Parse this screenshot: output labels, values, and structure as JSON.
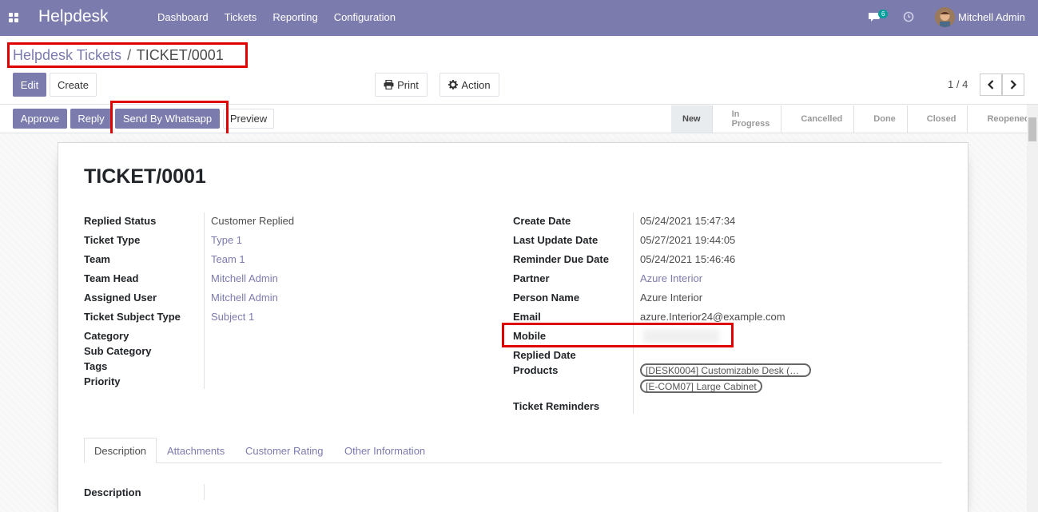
{
  "navbar": {
    "brand": "Helpdesk",
    "menu": [
      "Dashboard",
      "Tickets",
      "Reporting",
      "Configuration"
    ],
    "chat_count": "6",
    "user_name": "Mitchell Admin"
  },
  "breadcrumb": {
    "parent": "Helpdesk Tickets",
    "separator": "/",
    "current": "TICKET/0001"
  },
  "toolbar": {
    "edit": "Edit",
    "create": "Create",
    "print": "Print",
    "action": "Action",
    "pager": "1 / 4"
  },
  "status_buttons": {
    "approve": "Approve",
    "reply": "Reply",
    "send_whatsapp": "Send By Whatsapp",
    "preview": "Preview"
  },
  "stages": [
    "New",
    "In Progress",
    "Cancelled",
    "Done",
    "Closed",
    "Reopened"
  ],
  "active_stage": "New",
  "ticket": {
    "title": "TICKET/0001",
    "left_fields": {
      "replied_status": {
        "label": "Replied Status",
        "value": "Customer Replied"
      },
      "ticket_type": {
        "label": "Ticket Type",
        "value": "Type 1"
      },
      "team": {
        "label": "Team",
        "value": "Team 1"
      },
      "team_head": {
        "label": "Team Head",
        "value": "Mitchell Admin"
      },
      "assigned_user": {
        "label": "Assigned User",
        "value": "Mitchell Admin"
      },
      "subject_type": {
        "label": "Ticket Subject Type",
        "value": "Subject 1"
      },
      "category": {
        "label": "Category",
        "value": ""
      },
      "sub_category": {
        "label": "Sub Category",
        "value": ""
      },
      "tags": {
        "label": "Tags",
        "value": ""
      },
      "priority": {
        "label": "Priority",
        "value": ""
      }
    },
    "right_fields": {
      "create_date": {
        "label": "Create Date",
        "value": "05/24/2021 15:47:34"
      },
      "last_update": {
        "label": "Last Update Date",
        "value": "05/27/2021 19:44:05"
      },
      "reminder_due": {
        "label": "Reminder Due Date",
        "value": "05/24/2021 15:46:46"
      },
      "partner": {
        "label": "Partner",
        "value": "Azure Interior"
      },
      "person_name": {
        "label": "Person Name",
        "value": "Azure Interior"
      },
      "email": {
        "label": "Email",
        "value": "azure.Interior24@example.com"
      },
      "mobile": {
        "label": "Mobile",
        "value": ""
      },
      "replied_date": {
        "label": "Replied Date",
        "value": ""
      },
      "products": {
        "label": "Products",
        "items": [
          "[DESK0004] Customizable Desk (…",
          "[E-COM07] Large Cabinet"
        ]
      },
      "reminders": {
        "label": "Ticket Reminders",
        "value": ""
      }
    }
  },
  "tabs": [
    "Description",
    "Attachments",
    "Customer Rating",
    "Other Information"
  ],
  "description_label": "Description",
  "colors": {
    "brand": "#7c7bad",
    "highlight": "#e00000"
  },
  "icons": [
    "apps-grid-icon",
    "chat-icon",
    "clock-icon",
    "print-icon",
    "gear-icon",
    "chevron-left-icon",
    "chevron-right-icon"
  ]
}
